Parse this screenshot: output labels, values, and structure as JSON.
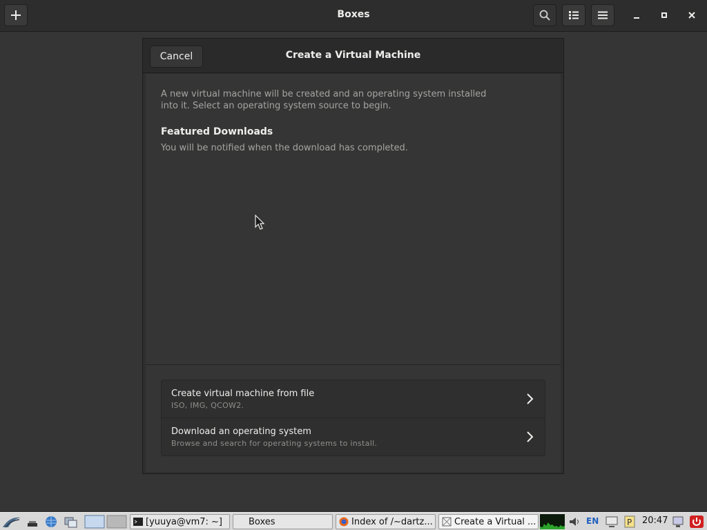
{
  "header": {
    "title": "Boxes",
    "new_icon": "plus-icon",
    "search_icon": "search-icon",
    "list_view_icon": "list-view-icon",
    "menu_icon": "hamburger-menu-icon"
  },
  "dialog": {
    "title": "Create a Virtual Machine",
    "cancel_label": "Cancel",
    "intro": "A new virtual machine will be created and an operating system installed into it. Select an operating system source to begin.",
    "featured_heading": "Featured Downloads",
    "featured_note": "You will be notified when the download has completed.",
    "sources": [
      {
        "title": "Create virtual machine from file",
        "subtitle": "ISO, IMG, QCOW2."
      },
      {
        "title": "Download an operating system",
        "subtitle": "Browse and search for operating systems to install."
      }
    ]
  },
  "taskbar": {
    "tasks": [
      {
        "label": "[yuuya@vm7: ~]",
        "icon": "terminal-icon"
      },
      {
        "label": "Boxes",
        "icon": ""
      },
      {
        "label": "Index of /~dartz...",
        "icon": "firefox-icon"
      },
      {
        "label": "Create a Virtual ...",
        "icon": "boxes-icon"
      }
    ],
    "language": "EN",
    "clock": "20:47"
  },
  "colors": {
    "background": "#353535",
    "header": "#2d2d2d",
    "text": "#eeeeec",
    "dim_text": "#a4a4a2",
    "taskbar": "#d8d8d8"
  }
}
